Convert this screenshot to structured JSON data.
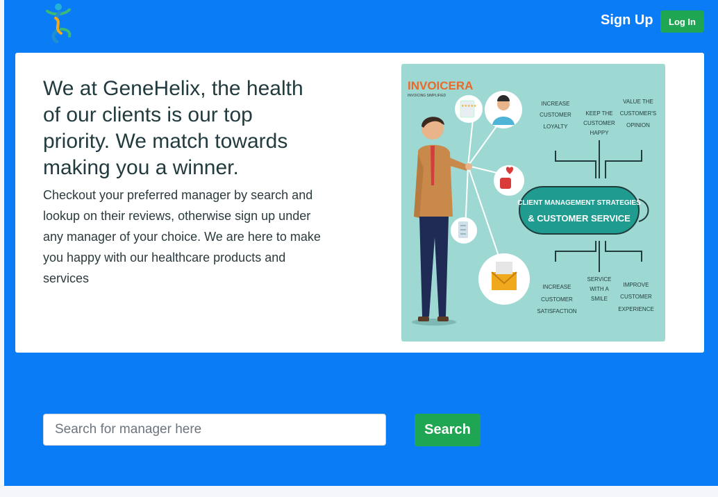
{
  "nav": {
    "signup_label": "Sign Up",
    "login_label": "Log In"
  },
  "hero": {
    "headline": "We at GeneHelix, the health of our clients is our top priority. We match towards making you a winner.",
    "description": "Checkout your preferred manager by search and lookup on their reviews, otherwise sign up under any manager of your choice. We are here to make you happy with our healthcare products and services",
    "illustration": {
      "brand": "INVOICERA",
      "brand_tagline": "INVOICING SIMPLIFIED",
      "center_line1": "CLIENT MANAGEMENT STRATEGIES",
      "center_line2": "& CUSTOMER SERVICE",
      "top_labels": [
        [
          "INCREASE",
          "CUSTOMER",
          "LOYALTY"
        ],
        [
          "KEEP THE",
          "CUSTOMER",
          "HAPPY"
        ],
        [
          "VALUE THE",
          "CUSTOMER'S",
          "OPINION"
        ]
      ],
      "bottom_labels": [
        [
          "INCREASE",
          "CUSTOMER",
          "SATISFACTION"
        ],
        [
          "SERVICE",
          "WITH A",
          "SMILE"
        ],
        [
          "IMPROVE",
          "CUSTOMER",
          "EXPERIENCE"
        ]
      ]
    }
  },
  "search": {
    "placeholder": "Search for manager here",
    "value": "",
    "button_label": "Search"
  },
  "colors": {
    "page_bg": "#0a7cf5",
    "button_green": "#1fa653",
    "illustration_bg": "#9ed8d2",
    "center_pill": "#1f9b8f"
  }
}
